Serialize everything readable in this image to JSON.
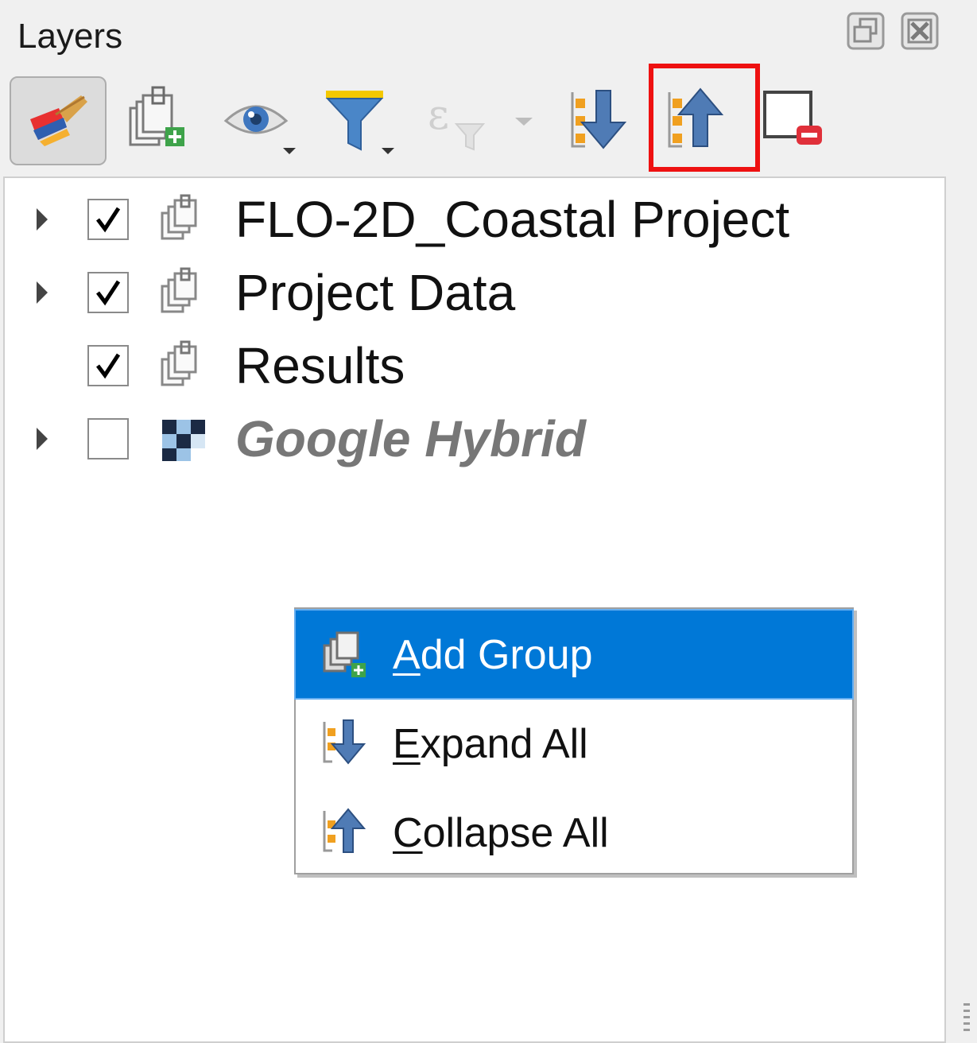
{
  "panel": {
    "title": "Layers",
    "float_icon": "float-dock-icon",
    "close_icon": "close-dock-icon"
  },
  "toolbar": {
    "buttons": [
      {
        "name": "style-manager-button",
        "icon": "paint-brush-icon",
        "active": true
      },
      {
        "name": "add-group-button",
        "icon": "add-group-icon"
      },
      {
        "name": "visibility-button",
        "icon": "eye-icon",
        "has_dropdown": true
      },
      {
        "name": "filter-legend-button",
        "icon": "funnel-icon",
        "has_dropdown": true
      },
      {
        "name": "filter-expression-button",
        "icon": "expression-filter-icon",
        "disabled": true,
        "has_dropdown": true
      },
      {
        "name": "expand-all-button",
        "icon": "expand-all-icon"
      },
      {
        "name": "collapse-all-button",
        "icon": "collapse-all-icon",
        "highlighted": true
      },
      {
        "name": "remove-layer-button",
        "icon": "remove-layer-icon"
      }
    ],
    "highlight_color": "#ee1111"
  },
  "tree": {
    "items": [
      {
        "label": "FLO-2D_Coastal Project",
        "checked": true,
        "expandable": true,
        "icon": "group-icon"
      },
      {
        "label": "Project Data",
        "checked": true,
        "expandable": true,
        "icon": "group-icon"
      },
      {
        "label": "Results",
        "checked": true,
        "expandable": false,
        "icon": "group-icon"
      },
      {
        "label": "Google Hybrid",
        "checked": false,
        "expandable": true,
        "icon": "raster-tile-icon",
        "style": "italic-disabled"
      }
    ]
  },
  "context_menu": {
    "items": [
      {
        "first": "A",
        "rest": "dd Group",
        "icon": "add-group-icon",
        "selected": true
      },
      {
        "first": "E",
        "rest": "xpand All",
        "icon": "expand-all-icon",
        "selected": false
      },
      {
        "first": "C",
        "rest": "ollapse All",
        "icon": "collapse-all-icon",
        "selected": false
      }
    ]
  },
  "colors": {
    "selection": "#0078d7",
    "panel_bg": "#f0f0f0",
    "arrow_blue": "#4f7bb5",
    "accent_orange": "#f0a020"
  }
}
